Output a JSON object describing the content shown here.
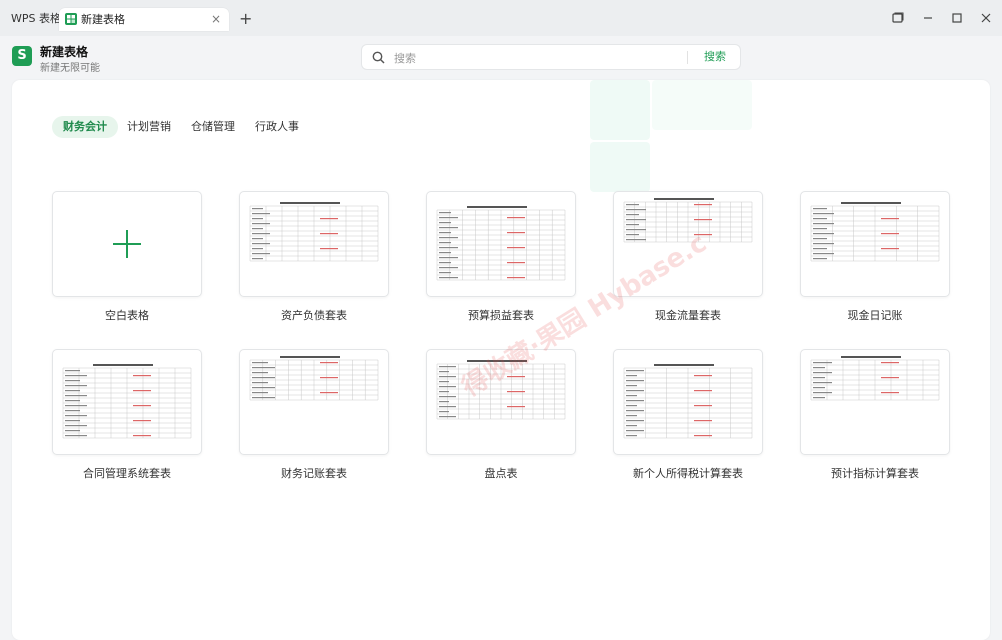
{
  "titlebar": {
    "app_tab": "WPS 表格",
    "doc_tab": "新建表格",
    "close_glyph": "×",
    "new_tab_glyph": "+"
  },
  "header": {
    "logo_letter": "S",
    "title": "新建表格",
    "subtitle": "新建无限可能"
  },
  "search": {
    "placeholder": "搜索",
    "button": "搜索"
  },
  "categories": [
    {
      "label": "财务会计",
      "active": true
    },
    {
      "label": "计划营销",
      "active": false
    },
    {
      "label": "仓储管理",
      "active": false
    },
    {
      "label": "行政人事",
      "active": false
    }
  ],
  "templates": [
    {
      "label": "空白表格",
      "kind": "blank"
    },
    {
      "label": "资产负债套表",
      "kind": "sheet"
    },
    {
      "label": "预算损益套表",
      "kind": "sheet"
    },
    {
      "label": "现金流量套表",
      "kind": "sheet"
    },
    {
      "label": "现金日记账",
      "kind": "sheet"
    },
    {
      "label": "合同管理系统套表",
      "kind": "sheet"
    },
    {
      "label": "财务记账套表",
      "kind": "sheet"
    },
    {
      "label": "盘点表",
      "kind": "sheet"
    },
    {
      "label": "新个人所得税计算套表",
      "kind": "sheet"
    },
    {
      "label": "预计指标计算套表",
      "kind": "sheet"
    }
  ],
  "watermark": "得收藏·果园 Hybase.c",
  "colors": {
    "accent": "#1f9d55",
    "active_tab_bg": "#e7f5ec"
  }
}
